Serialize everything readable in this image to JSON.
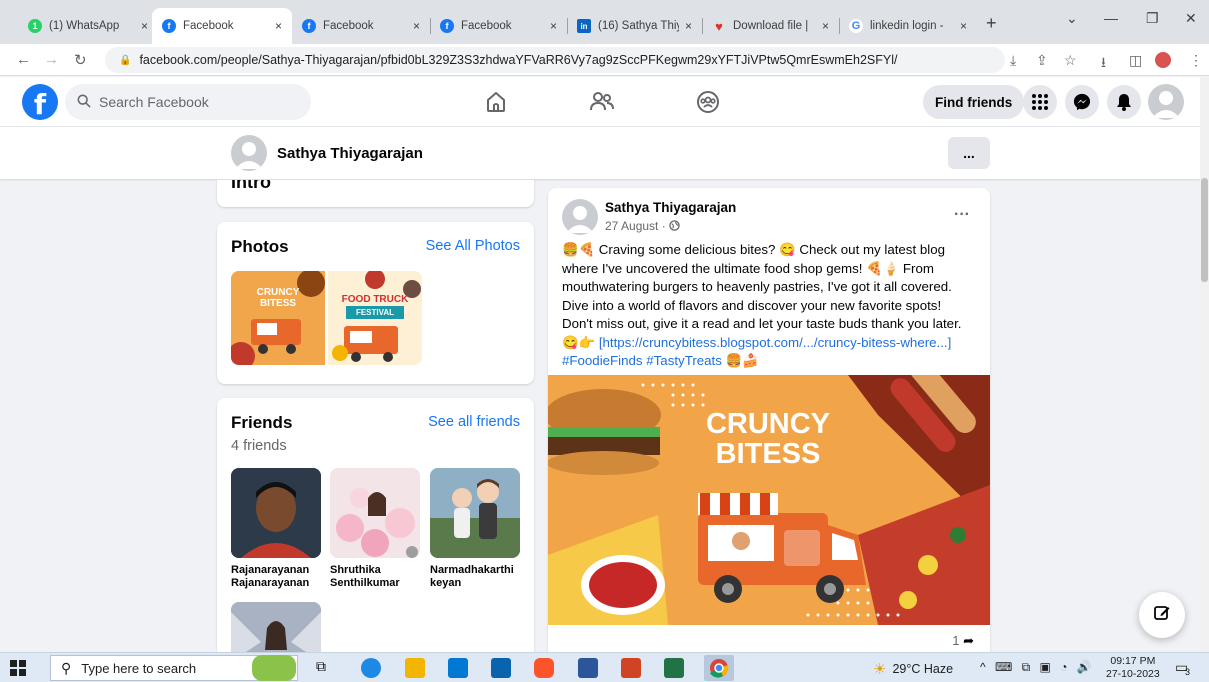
{
  "browser": {
    "tabs": [
      {
        "label": "(1) WhatsApp",
        "icon": "whatsapp-icon",
        "color": "#25d366",
        "glyph": "1"
      },
      {
        "label": "Facebook",
        "icon": "facebook-icon",
        "color": "#1877f2",
        "glyph": "f"
      },
      {
        "label": "Facebook",
        "icon": "facebook-icon",
        "color": "#1877f2",
        "glyph": "f"
      },
      {
        "label": "Facebook",
        "icon": "facebook-icon",
        "color": "#1877f2",
        "glyph": "f"
      },
      {
        "label": "(16) Sathya Thiy",
        "icon": "linkedin-icon",
        "color": "#0a66c2",
        "glyph": "in"
      },
      {
        "label": "Download file |",
        "icon": "heart-icon",
        "color": "#e03131",
        "glyph": "♥"
      },
      {
        "label": "linkedin login -",
        "icon": "google-icon",
        "color": "#ffffff",
        "glyph": "G"
      }
    ],
    "active_tab": 1,
    "close_glyph": "×",
    "new_tab_glyph": "+",
    "url": "facebook.com/people/Sathya-Thiyagarajan/pfbid0bL329Z3S3zhdwaYFVaRR6Vy7ag9zSccPFKegwm29xYFTJiVPtw5QmrEswmEh2SFYl/"
  },
  "fb": {
    "search_placeholder": "Search Facebook",
    "find_friends": "Find friends",
    "brand_color": "#1877f2"
  },
  "profile": {
    "name": "Sathya Thiyagarajan",
    "more": "..."
  },
  "intro": {
    "title": "Intro"
  },
  "photos": {
    "title": "Photos",
    "link": "See All Photos",
    "items": [
      {
        "text1": "CRUNCY",
        "text2": "BITESS"
      },
      {
        "text1": "FOOD TRUCK",
        "text2": "FESTIVAL"
      }
    ]
  },
  "friends": {
    "title": "Friends",
    "link": "See all friends",
    "count": "4 friends",
    "items": [
      {
        "name": "Rajanarayanan Rajanarayanan"
      },
      {
        "name": "Shruthika Senthilkumar"
      },
      {
        "name": "Narmadhakarthi keyan"
      }
    ]
  },
  "post": {
    "author": "Sathya Thiyagarajan",
    "date": "27 August ·",
    "more": "···",
    "text_lines": [
      "🍔🍕 Craving some delicious bites? 😋 Check out my latest blog",
      "where I've uncovered the ultimate food shop gems! 🍕🍦 From",
      "mouthwatering burgers to heavenly pastries, I've got it all covered.",
      "Dive into a world of flavors and discover your new favorite spots!",
      "Don't miss out, give it a read and let your taste buds thank you later."
    ],
    "link_text": "[https://cruncybitess.blogspot.com/.../cruncy-bitess-where...]",
    "link_prefix": "😋👉 ",
    "hashtags": "#FoodieFinds #TastyTreats",
    "hashtags_suffix": " 🍔🍰",
    "image_title_1": "CRUNCY",
    "image_title_2": "BITESS",
    "share_count": "1"
  },
  "taskbar": {
    "search_placeholder": "Type here to search",
    "weather": "29°C  Haze",
    "time": "09:17 PM",
    "date": "27-10-2023",
    "notif_count": "3"
  }
}
